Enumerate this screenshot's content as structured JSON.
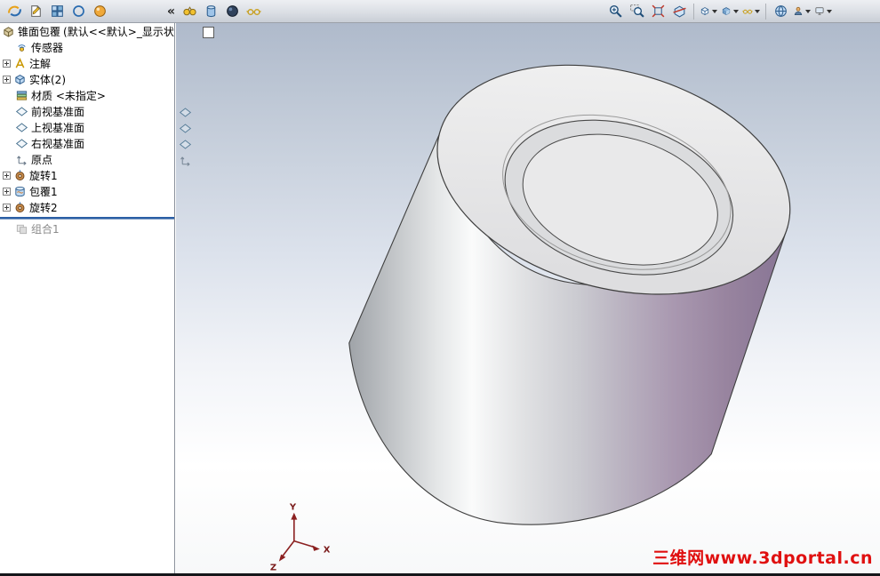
{
  "toolbar": {
    "collapse_glyph": "«",
    "left_icons": [
      "features-icon",
      "sketch-page-icon",
      "blocks-grid-icon",
      "circle-tool-icon",
      "render-ball-icon"
    ],
    "mid_icons": [
      "binoculars-icon",
      "cylinder-icon",
      "dark-sphere-icon",
      "glasses-icon"
    ],
    "right_icons": [
      "zoom-in-icon",
      "zoom-area-icon",
      "zoom-fit-icon",
      "section-view-icon",
      "view-orientation-icon",
      "display-style-icon",
      "hide-show-items-icon",
      "apply-scene-icon",
      "edit-appearance-icon",
      "view-settings-icon"
    ]
  },
  "feature_tree": {
    "title": "锥面包覆",
    "state": "(默认<<默认>_显示状...",
    "items": [
      {
        "label": "传感器",
        "icon": "sensors"
      },
      {
        "label": "注解",
        "icon": "annotations",
        "expandable": true
      },
      {
        "label": "实体(2)",
        "icon": "solid-bodies",
        "expandable": true
      },
      {
        "label": "材质 <未指定>",
        "icon": "material"
      },
      {
        "label": "前视基准面",
        "icon": "plane"
      },
      {
        "label": "上视基准面",
        "icon": "plane"
      },
      {
        "label": "右视基准面",
        "icon": "plane"
      },
      {
        "label": "原点",
        "icon": "origin"
      },
      {
        "label": "旋转1",
        "icon": "revolve",
        "expandable": true
      },
      {
        "label": "包覆1",
        "icon": "wrap",
        "expandable": true
      },
      {
        "label": "旋转2",
        "icon": "revolve",
        "expandable": true
      },
      {
        "label": "组合1",
        "icon": "combine",
        "grayed": true,
        "below_rollback_bar": true
      }
    ]
  },
  "viewport": {
    "triad": {
      "x": "X",
      "y": "Y",
      "z": "Z"
    },
    "watermark": "三维网www.3dportal.cn",
    "scene": {
      "shape": "truncated-cone-with-circular-top-groove",
      "face_color": "#EAEAEA",
      "highlight_color": "#FAFBFB",
      "accent_color": "#8F7D99",
      "background_top": "#AFBACB",
      "background_bottom": "#FFFFFF"
    }
  },
  "colors": {
    "rollback_bar": "#2B5FA5",
    "toolbar_bg": "#D9DDE3",
    "tree_bg": "#FFFFFF",
    "grayed_text": "#8A8A8A",
    "watermark_red": "#E01010",
    "triad_red": "#8B2020"
  }
}
